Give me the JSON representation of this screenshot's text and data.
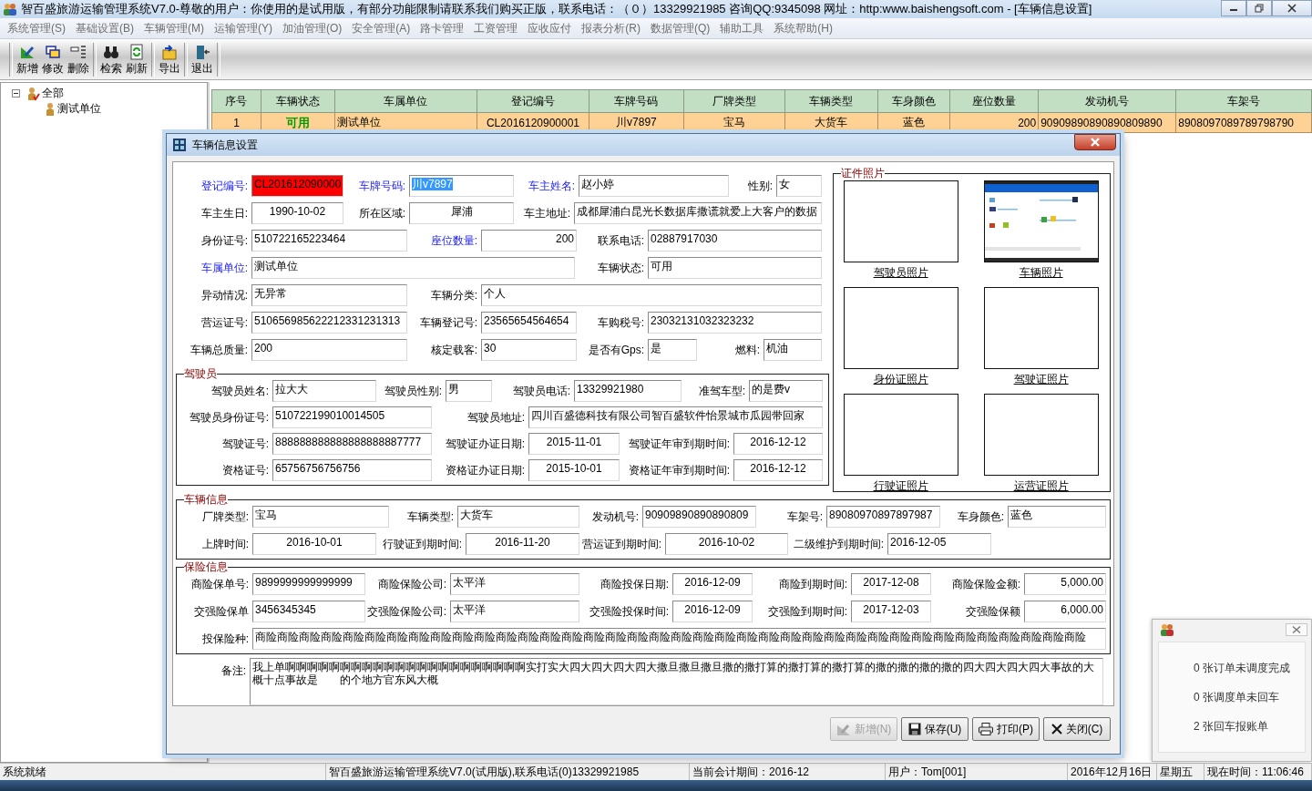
{
  "window": {
    "title": "智百盛旅游运输管理系统V7.0-尊敬的用户：你使用的是试用版，有部分功能限制请联系我们购买正版，联系电话：（０）13329921985 咨询QQ:9345098 网址：http:www.baishengsoft.com - [车辆信息设置]"
  },
  "menu": [
    "系统管理(S)",
    "基础设置(B)",
    "车辆管理(M)",
    "运输管理(Y)",
    "加油管理(O)",
    "安全管理(A)",
    "路卡管理",
    "工资管理",
    "应收应付",
    "报表分析(R)",
    "数据管理(Q)",
    "辅助工具",
    "系统帮助(H)"
  ],
  "toolbar": [
    [
      {
        "label": "新增",
        "kind": "add"
      },
      {
        "label": "修改",
        "kind": "edit"
      },
      {
        "label": "删除",
        "kind": "delete"
      }
    ],
    [
      {
        "label": "检索",
        "kind": "search"
      },
      {
        "label": "刷新",
        "kind": "refresh"
      }
    ],
    [
      {
        "label": "导出",
        "kind": "export"
      }
    ],
    [
      {
        "label": "退出",
        "kind": "exit"
      }
    ]
  ],
  "tree": [
    {
      "label": "全部",
      "kind": "root",
      "expanded": true,
      "children": [
        {
          "label": "测试单位",
          "kind": "unit"
        }
      ]
    }
  ],
  "table": {
    "columns": [
      "序号",
      "车辆状态",
      "车属单位",
      "登记编号",
      "车牌号码",
      "厂牌类型",
      "车辆类型",
      "车身颜色",
      "座位数量",
      "发动机号",
      "车架号"
    ],
    "rows": [
      {
        "selected": true,
        "color": "#009a00",
        "cells": [
          "1",
          "可用",
          "测试单位",
          "CL2016120900001",
          "川v7897",
          "宝马",
          "大货车",
          "蓝色",
          "200",
          "90909890890890809890",
          "8908097089789798790"
        ]
      }
    ]
  },
  "dialog": {
    "title": "车辆信息设置",
    "basic": [
      [
        {
          "label": "登记编号:",
          "value": "CL201612090000",
          "required": true,
          "invalid": true,
          "text_selected": false
        },
        {
          "label": "车牌号码:",
          "value": "川v7897",
          "required": true,
          "invalid": false,
          "text_selected": true
        },
        {
          "label": "车主姓名:",
          "value": "赵小婷",
          "required": true,
          "invalid": false,
          "text_selected": false
        },
        {
          "label": "性别:",
          "value": "女",
          "required": false,
          "invalid": false,
          "text_selected": false
        }
      ],
      [
        {
          "label": "车主生日:",
          "value": "1990-10-02",
          "required": false,
          "invalid": false,
          "text_selected": false
        },
        {
          "label": "所在区域:",
          "value": "犀浦",
          "required": false,
          "invalid": false,
          "text_selected": false
        },
        {
          "label": "车主地址:",
          "value": "成都犀浦白昆光长数据库撒谎就爱上大客户的数据",
          "required": false,
          "invalid": false,
          "text_selected": false
        }
      ],
      [
        {
          "label": "身份证号:",
          "value": "510722165223464",
          "required": false,
          "invalid": false,
          "text_selected": false
        },
        {
          "label": "座位数量:",
          "value": "200",
          "required": true,
          "invalid": false,
          "text_selected": false
        },
        {
          "label": "联系电话:",
          "value": "02887917030",
          "required": false,
          "invalid": false,
          "text_selected": false
        }
      ],
      [
        {
          "label": "车属单位:",
          "value": "测试单位",
          "required": true,
          "invalid": false,
          "text_selected": false
        },
        {
          "label": "车辆状态:",
          "value": "可用",
          "required": false,
          "invalid": false,
          "text_selected": false
        }
      ],
      [
        {
          "label": "异动情况:",
          "value": "无异常",
          "required": false,
          "invalid": false,
          "text_selected": false
        },
        {
          "label": "车辆分类:",
          "value": "个人",
          "required": false,
          "invalid": false,
          "text_selected": false
        }
      ],
      [
        {
          "label": "营运证号:",
          "value": "510656985622212331231313",
          "required": false,
          "invalid": false,
          "text_selected": false
        },
        {
          "label": "车辆登记号:",
          "value": "23565654564654",
          "required": false,
          "invalid": false,
          "text_selected": false
        },
        {
          "label": "车购税号:",
          "value": "23032131032323232",
          "required": false,
          "invalid": false,
          "text_selected": false
        }
      ],
      [
        {
          "label": "车辆总质量:",
          "value": "200",
          "required": false,
          "invalid": false,
          "text_selected": false
        },
        {
          "label": "核定载客:",
          "value": "30",
          "required": false,
          "invalid": false,
          "text_selected": false
        },
        {
          "label": "是否有Gps:",
          "value": "是",
          "required": false,
          "invalid": false,
          "text_selected": false
        },
        {
          "label": "燃料:",
          "value": "机油",
          "required": false,
          "invalid": false,
          "text_selected": false
        }
      ]
    ],
    "driver": {
      "title": "驾驶员",
      "rows": [
        [
          {
            "label": "驾驶员姓名:",
            "value": "拉大大"
          },
          {
            "label": "驾驶员性别:",
            "value": "男"
          },
          {
            "label": "驾驶员电话:",
            "value": "13329921980"
          },
          {
            "label": "准驾车型:",
            "value": "的是费v"
          }
        ],
        [
          {
            "label": "驾驶员身份证号:",
            "value": "510722199010014505"
          },
          {
            "label": "驾驶员地址:",
            "value": "四川百盛德科技有限公司智百盛软件怡景城市瓜园带回家"
          }
        ],
        [
          {
            "label": "驾驶证号:",
            "value": "888888888888888888887777"
          },
          {
            "label": "驾驶证办证日期:",
            "value": "2015-11-01"
          },
          {
            "label": "驾驶证年审到期时间:",
            "value": "2016-12-12"
          }
        ],
        [
          {
            "label": "资格证号:",
            "value": "65756756756756"
          },
          {
            "label": "资格证办证日期:",
            "value": "2015-10-01"
          },
          {
            "label": "资格证年审到期时间:",
            "value": "2016-12-12"
          }
        ]
      ]
    },
    "photos": {
      "title": "证件照片",
      "items": [
        {
          "label": "驾驶员照片",
          "kind": "empty"
        },
        {
          "label": "车辆照片",
          "kind": "picture"
        },
        {
          "label": "身份证照片",
          "kind": "empty"
        },
        {
          "label": "驾驶证照片",
          "kind": "empty"
        },
        {
          "label": "行驶证照片",
          "kind": "empty"
        },
        {
          "label": "运营证照片",
          "kind": "empty"
        }
      ]
    },
    "vehicle": {
      "title": "车辆信息",
      "rows": [
        [
          {
            "label": "厂牌类型:",
            "value": "宝马"
          },
          {
            "label": "车辆类型:",
            "value": "大货车"
          },
          {
            "label": "发动机号:",
            "value": "90909890890890809"
          },
          {
            "label": "车架号:",
            "value": "89080970897897987"
          },
          {
            "label": "车身颜色:",
            "value": "蓝色"
          }
        ],
        [
          {
            "label": "上牌时间:",
            "value": "2016-10-01"
          },
          {
            "label": "行驶证到期时间:",
            "value": "2016-11-20"
          },
          {
            "label": "营运证到期时间:",
            "value": "2016-10-02"
          },
          {
            "label": "二级维护到期时间:",
            "value": "2016-12-05"
          }
        ]
      ]
    },
    "insurance": {
      "title": "保险信息",
      "rows": [
        [
          {
            "label": "商险保单号:",
            "value": "9899999999999999"
          },
          {
            "label": "商险保险公司:",
            "value": "太平洋"
          },
          {
            "label": "商险投保日期:",
            "value": "2016-12-09"
          },
          {
            "label": "商险到期时间:",
            "value": "2017-12-08"
          },
          {
            "label": "商险保险金额:",
            "value": "5,000.00"
          }
        ],
        [
          {
            "label": "交强险保单",
            "value": "3456345345"
          },
          {
            "label": "交强险保险公司:",
            "value": "太平洋"
          },
          {
            "label": "交强险投保时间:",
            "value": "2016-12-09"
          },
          {
            "label": "交强险到期时间:",
            "value": "2017-12-03"
          },
          {
            "label": "交强险保额",
            "value": "6,000.00"
          }
        ],
        [
          {
            "label": "投保险种:",
            "value": "商险商险商险商险商险商险商险商险商险商险商险商险商险商险商险商险商险商险商险商险商险商险商险商险商险商险商险商险商险商险商险商险商险商险商险商险商险商险"
          }
        ]
      ]
    },
    "remark": {
      "label": "备注:",
      "value": "我上单啊啊啊啊啊啊啊啊啊啊啊啊啊啊啊啊啊啊啊啊啊啊实打实大四大四大四大四大撒旦撒旦撒旦撒的撒打算的撒打算的撒打算的撒的撒的撒的撒的四大四大四大四大事故的大概十点事故是　　的个地方官东风大概"
    },
    "buttons": [
      {
        "label": "新增(N)",
        "kind": "add",
        "disabled": true
      },
      {
        "label": "保存(U)",
        "kind": "save",
        "disabled": false
      },
      {
        "label": "打印(P)",
        "kind": "print",
        "disabled": false
      },
      {
        "label": "关闭(C)",
        "kind": "close",
        "disabled": false
      }
    ]
  },
  "notification": {
    "lines": [
      "0 张订单未调度完成",
      "0 张调度单未回车",
      "2 张回车报账单"
    ]
  },
  "status_bar": [
    "系统就绪",
    "智百盛旅游运输管理系统V7.0(试用版),联系电话(0)13329921985",
    "当前会计期间：2016-12",
    "用户：Tom[001]",
    "2016年12月16日",
    "星期五",
    "现在时间：11:06:46"
  ]
}
